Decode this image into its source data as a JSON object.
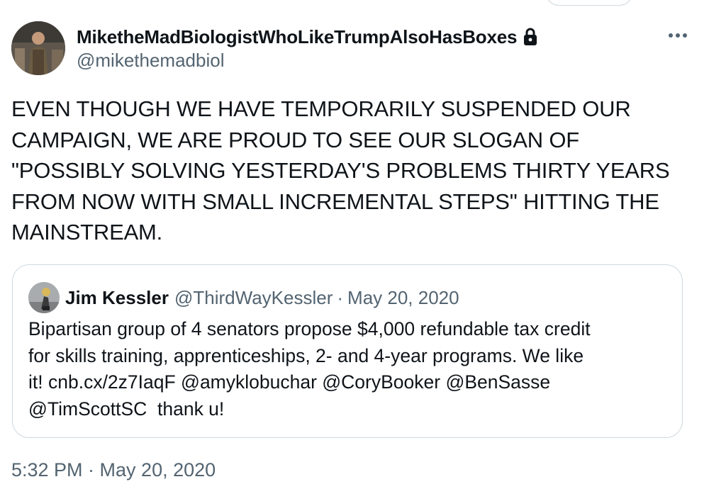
{
  "author": {
    "display_name": "MiketheMadBiologistWhoLikeTrumpAlsoHasBoxes",
    "handle": "@mikethemadbiol",
    "protected_icon": "lock-icon",
    "more_icon": "more-dots-icon"
  },
  "tweet": {
    "text": "EVEN THOUGH WE HAVE TEMPORARILY SUSPENDED OUR\nCAMPAIGN, WE ARE PROUD TO SEE OUR SLOGAN OF\n\"POSSIBLY SOLVING YESTERDAY'S PROBLEMS THIRTY YEARS\nFROM NOW WITH SMALL INCREMENTAL STEPS\" HITTING THE\nMAINSTREAM.",
    "timestamp": "5:32 PM · May 20, 2020"
  },
  "quoted_tweet": {
    "display_name": "Jim Kessler",
    "handle": "@ThirdWayKessler",
    "separator": "·",
    "date": "May 20, 2020",
    "text": "Bipartisan group of 4 senators propose $4,000 refundable tax credit\nfor skills training, apprenticeships, 2- and 4-year programs. We like\nit! cnb.cx/2z7IaqF @amyklobuchar @CoryBooker @BenSasse\n@TimScottSC  thank u!"
  },
  "colors": {
    "text": "#0f1419",
    "secondary_text": "#536471",
    "border": "#cfd9de",
    "background": "#ffffff"
  }
}
